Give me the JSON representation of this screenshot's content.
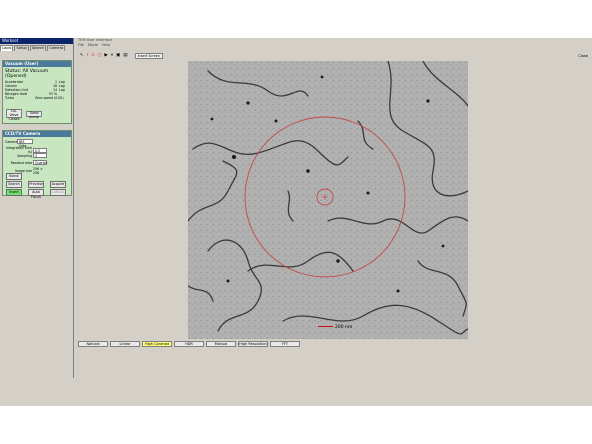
{
  "workset": {
    "title": "Workset",
    "tabs": [
      "Lapis",
      "Setup",
      "Search",
      "Camera"
    ],
    "active_tab": 0
  },
  "vacuum": {
    "header": "Vacuum (User)",
    "status": "Status: All Vacuum (Opened)",
    "rows": [
      {
        "name": "Accelerator",
        "value": "1",
        "unit": "Log"
      },
      {
        "name": "Column",
        "value": "18",
        "unit": "Log"
      },
      {
        "name": "Detection Unit",
        "value": "14",
        "unit": "Log"
      },
      {
        "name": "Nitrogen level",
        "value": "93 %",
        "unit": ""
      },
      {
        "name": "Turbo",
        "value": "Zero speed (0.00)",
        "unit": ""
      }
    ],
    "col_valve_label": "Col. Valve Closed",
    "turbo_pump_label": "Turbo pump"
  },
  "camera": {
    "header": "CCD/TV Camera",
    "camera_label": "Camera",
    "camera_value": "BM-Ceta",
    "integration_label": "Integration time (s)",
    "integration_value": "0.5",
    "sampling_label": "Sampling",
    "sampling_value": "4",
    "readout_label": "Readout area",
    "readout_value": "Quarter",
    "image_size_label": "Image size",
    "image_size_value": "256 × 256",
    "buttons": {
      "blank": "Blank",
      "search": "Search",
      "preview": "Preview",
      "acquire": "Acquire",
      "insert": "Insert",
      "auto_focus": "Auto Focus",
      "cancel": "CANCEL"
    }
  },
  "main": {
    "title": "TEM User Interface",
    "menu": [
      "File",
      "Mode",
      "Help"
    ],
    "insert_screen_label": "Insert Screen",
    "close_label": "Close",
    "scalebar_label": "200 nm",
    "filters": [
      "Natural",
      "Linear",
      "High Contrast",
      "HDR",
      "Manual",
      "High Resolution",
      "FFT"
    ],
    "active_filter": 2
  },
  "colors": {
    "title_blue": "#0a246a",
    "panel_green": "#c8e6c0",
    "status_panel": "#7ecf7e",
    "highlight_yellow": "#ffe000",
    "accent_red": "#d01010"
  }
}
